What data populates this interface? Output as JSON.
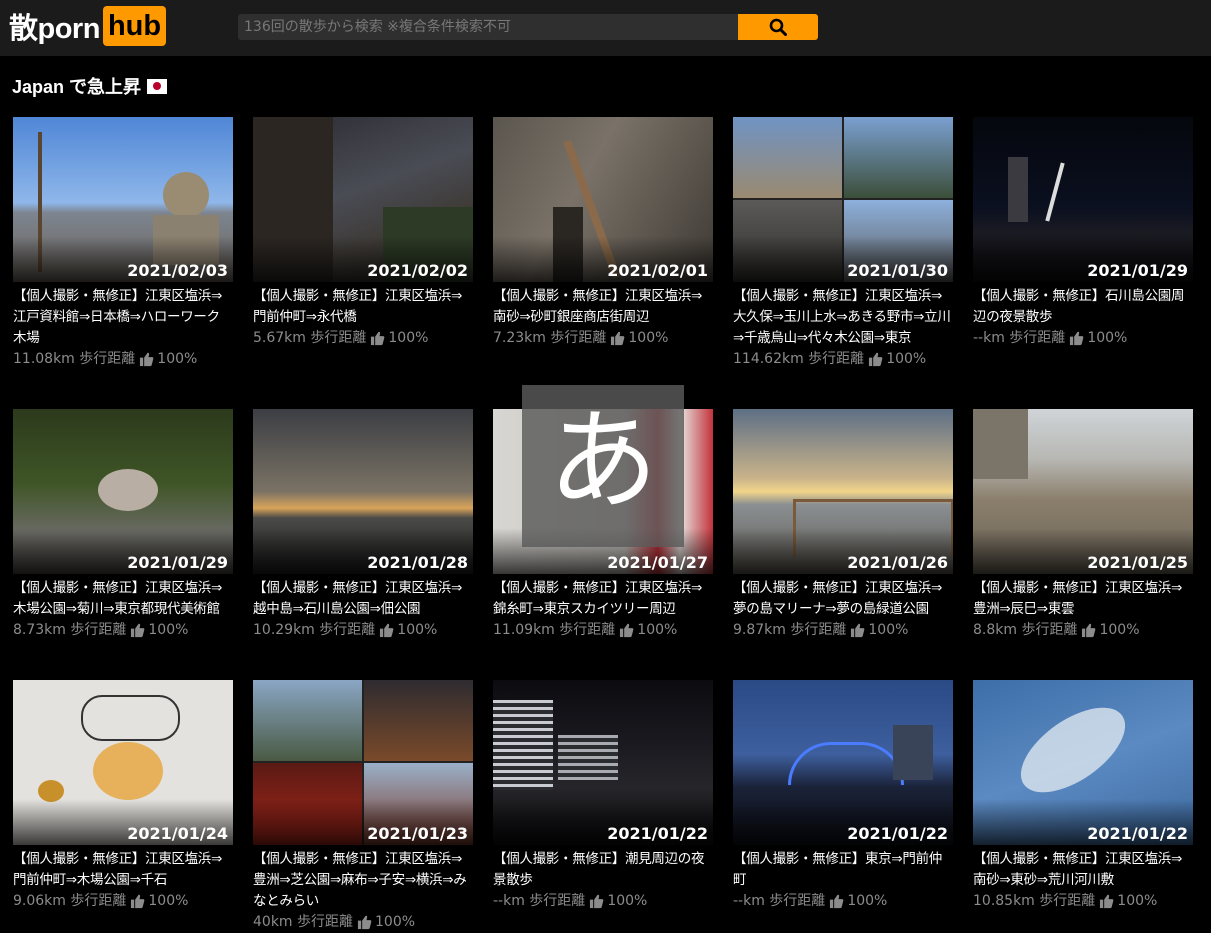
{
  "header": {
    "logo_text": "散porn",
    "logo_badge": "hub",
    "search_placeholder": "136回の散歩から検索 ※複合条件検索不可",
    "search_icon": "search-icon"
  },
  "section": {
    "title": "Japan で急上昇",
    "flag_icon": "japan-flag-icon"
  },
  "overlay": {
    "char": "あ"
  },
  "videos": [
    {
      "date": "2021/02/03",
      "title": "【個人撮影・無修正】江東区塩浜⇒江戸資料館⇒日本橋⇒ハローワーク木場",
      "distance": "11.08km 歩行距離",
      "rating": "100%"
    },
    {
      "date": "2021/02/02",
      "title": "【個人撮影・無修正】江東区塩浜⇒門前仲町⇒永代橋",
      "distance": "5.67km 歩行距離",
      "rating": "100%"
    },
    {
      "date": "2021/02/01",
      "title": "【個人撮影・無修正】江東区塩浜⇒南砂⇒砂町銀座商店街周辺",
      "distance": "7.23km 歩行距離",
      "rating": "100%"
    },
    {
      "date": "2021/01/30",
      "title": "【個人撮影・無修正】江東区塩浜⇒大久保⇒玉川上水⇒あきる野市⇒立川⇒千歳烏山⇒代々木公園⇒東京",
      "distance": "114.62km 歩行距離",
      "rating": "100%"
    },
    {
      "date": "2021/01/29",
      "title": "【個人撮影・無修正】石川島公園周辺の夜景散歩",
      "distance": "--km 歩行距離",
      "rating": "100%"
    },
    {
      "date": "2021/01/29",
      "title": "【個人撮影・無修正】江東区塩浜⇒木場公園⇒菊川⇒東京都現代美術館",
      "distance": "8.73km 歩行距離",
      "rating": "100%"
    },
    {
      "date": "2021/01/28",
      "title": "【個人撮影・無修正】江東区塩浜⇒越中島⇒石川島公園⇒佃公園",
      "distance": "10.29km 歩行距離",
      "rating": "100%"
    },
    {
      "date": "2021/01/27",
      "title": "【個人撮影・無修正】江東区塩浜⇒錦糸町⇒東京スカイツリー周辺",
      "distance": "11.09km 歩行距離",
      "rating": "100%"
    },
    {
      "date": "2021/01/26",
      "title": "【個人撮影・無修正】江東区塩浜⇒夢の島マリーナ⇒夢の島緑道公園",
      "distance": "9.87km 歩行距離",
      "rating": "100%"
    },
    {
      "date": "2021/01/25",
      "title": "【個人撮影・無修正】江東区塩浜⇒豊洲⇒辰巳⇒東雲",
      "distance": "8.8km 歩行距離",
      "rating": "100%"
    },
    {
      "date": "2021/01/24",
      "title": "【個人撮影・無修正】江東区塩浜⇒門前仲町⇒木場公園⇒千石",
      "distance": "9.06km 歩行距離",
      "rating": "100%"
    },
    {
      "date": "2021/01/23",
      "title": "【個人撮影・無修正】江東区塩浜⇒豊洲⇒芝公園⇒麻布⇒子安⇒横浜⇒みなとみらい",
      "distance": "40km 歩行距離",
      "rating": "100%"
    },
    {
      "date": "2021/01/22",
      "title": "【個人撮影・無修正】潮見周辺の夜景散歩",
      "distance": "--km 歩行距離",
      "rating": "100%"
    },
    {
      "date": "2021/01/22",
      "title": "【個人撮影・無修正】東京⇒門前仲町",
      "distance": "--km 歩行距離",
      "rating": "100%"
    },
    {
      "date": "2021/01/22",
      "title": "【個人撮影・無修正】江東区塩浜⇒南砂⇒東砂⇒荒川河川敷",
      "distance": "10.85km 歩行距離",
      "rating": "100%"
    }
  ]
}
